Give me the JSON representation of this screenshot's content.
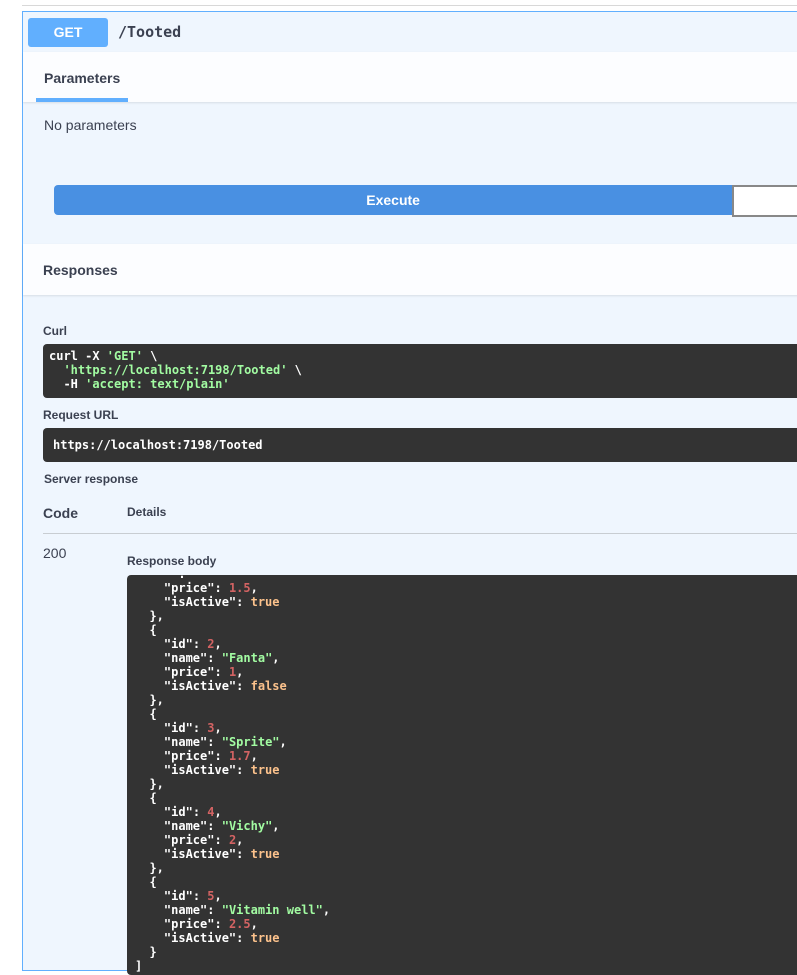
{
  "operation": {
    "method": "GET",
    "path": "/Tooted"
  },
  "parameters": {
    "tab_label": "Parameters",
    "empty_text": "No parameters"
  },
  "execute_label": "Execute",
  "responses": {
    "title": "Responses",
    "curl_label": "Curl",
    "curl": {
      "cmd": "curl -X ",
      "method": "'GET'",
      "cont1": " \\",
      "url": "'https://localhost:7198/Tooted'",
      "cont2": " \\",
      "header_flag": "  -H ",
      "header": "'accept: text/plain'"
    },
    "request_url_label": "Request URL",
    "request_url": "https://localhost:7198/Tooted",
    "server_response_label": "Server response",
    "code_col": "Code",
    "details_col": "Details",
    "status_code": "200",
    "response_body_label": "Response body",
    "body_head": {
      "price": "1.5",
      "isActive": "true"
    },
    "items": [
      {
        "id": "2",
        "name": "\"Fanta\"",
        "price": "1",
        "isActive": "false"
      },
      {
        "id": "3",
        "name": "\"Sprite\"",
        "price": "1.7",
        "isActive": "true"
      },
      {
        "id": "4",
        "name": "\"Vichy\"",
        "price": "2",
        "isActive": "true"
      },
      {
        "id": "5",
        "name": "\"Vitamin well\"",
        "price": "2.5",
        "isActive": "true"
      }
    ],
    "keys": {
      "id": "\"id\"",
      "name": "\"name\"",
      "price": "\"price\"",
      "isActive": "\"isActive\""
    }
  }
}
